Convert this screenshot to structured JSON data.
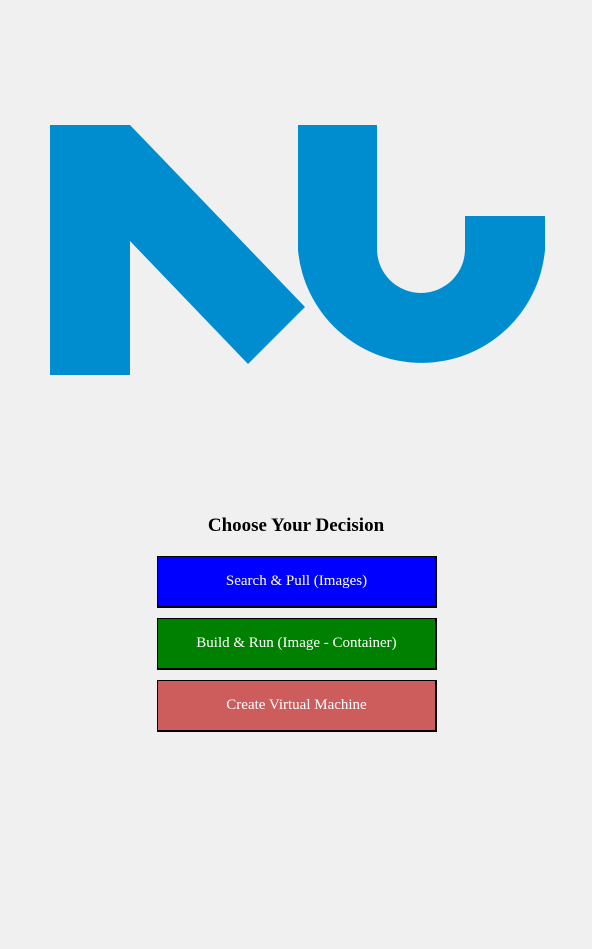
{
  "logo": {
    "icon": "nu-logo",
    "color": "#008dd0"
  },
  "menu": {
    "heading": "Choose Your Decision",
    "buttons": [
      {
        "label": "Search & Pull (Images)",
        "color": "#0000ff"
      },
      {
        "label": "Build & Run (Image - Container)",
        "color": "#008000"
      },
      {
        "label": "Create Virtual Machine",
        "color": "#cd5c5c"
      }
    ]
  }
}
